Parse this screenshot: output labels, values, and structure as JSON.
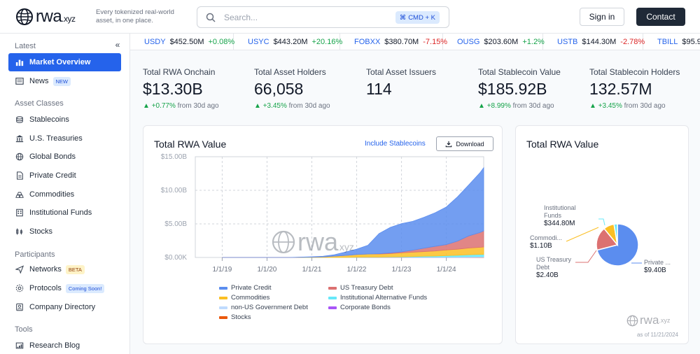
{
  "header": {
    "logo_text": "rwa",
    "logo_suffix": ".xyz",
    "tagline": "Every tokenized real-world asset, in one place.",
    "search_placeholder": "Search...",
    "search_shortcut": "CMD + K",
    "signin_label": "Sign in",
    "contact_label": "Contact"
  },
  "sidebar": {
    "latest_title": "Latest",
    "latest": [
      {
        "label": "Market Overview",
        "icon": "chart-bars-icon",
        "active": true
      },
      {
        "label": "News",
        "icon": "news-icon",
        "badge": "NEW"
      }
    ],
    "asset_title": "Asset Classes",
    "assets": [
      {
        "label": "Stablecoins",
        "icon": "coins-icon"
      },
      {
        "label": "U.S. Treasuries",
        "icon": "bank-icon"
      },
      {
        "label": "Global Bonds",
        "icon": "globe-icon"
      },
      {
        "label": "Private Credit",
        "icon": "document-icon"
      },
      {
        "label": "Commodities",
        "icon": "gold-bars-icon"
      },
      {
        "label": "Institutional Funds",
        "icon": "building-icon"
      },
      {
        "label": "Stocks",
        "icon": "stock-chart-icon"
      }
    ],
    "participants_title": "Participants",
    "participants": [
      {
        "label": "Networks",
        "icon": "network-icon",
        "badge": "BETA"
      },
      {
        "label": "Protocols",
        "icon": "protocol-icon",
        "badge": "Coming Soon!"
      },
      {
        "label": "Company Directory",
        "icon": "directory-icon"
      }
    ],
    "tools_title": "Tools",
    "tools": [
      {
        "label": "Research Blog",
        "icon": "blog-icon"
      }
    ]
  },
  "ticker": [
    {
      "symbol": "USDY",
      "value": "$452.50M",
      "change": "+0.08%",
      "dir": "pos"
    },
    {
      "symbol": "USYC",
      "value": "$443.20M",
      "change": "+20.16%",
      "dir": "pos"
    },
    {
      "symbol": "FOBXX",
      "value": "$380.70M",
      "change": "-7.15%",
      "dir": "neg"
    },
    {
      "symbol": "OUSG",
      "value": "$203.60M",
      "change": "+1.2%",
      "dir": "pos"
    },
    {
      "symbol": "USTB",
      "value": "$144.30M",
      "change": "-2.78%",
      "dir": "neg"
    },
    {
      "symbol": "TBILL",
      "value": "$95.9",
      "change": "",
      "dir": "pos"
    }
  ],
  "stats": [
    {
      "label": "Total RWA Onchain",
      "value": "$13.30B",
      "change": "+0.77%",
      "suffix": "from 30d ago"
    },
    {
      "label": "Total Asset Holders",
      "value": "66,058",
      "change": "+3.45%",
      "suffix": "from 30d ago"
    },
    {
      "label": "Total Asset Issuers",
      "value": "114",
      "change": "",
      "suffix": ""
    },
    {
      "label": "Total Stablecoin Value",
      "value": "$185.92B",
      "change": "+8.99%",
      "suffix": "from 30d ago"
    },
    {
      "label": "Total Stablecoin Holders",
      "value": "132.57M",
      "change": "+3.45%",
      "suffix": "from 30d ago"
    }
  ],
  "area_card": {
    "title": "Total RWA Value",
    "include_label": "Include Stablecoins",
    "download_label": "Download",
    "watermark_text": "rwa",
    "watermark_suffix": ".xyz"
  },
  "pie_card": {
    "title": "Total RWA Value",
    "watermark_text": "rwa",
    "watermark_suffix": ".xyz",
    "asof": "as of 11/21/2024",
    "labels": [
      {
        "name": "Institutional Funds",
        "value": "$344.80M"
      },
      {
        "name": "Commodi...",
        "value": "$1.10B"
      },
      {
        "name": "US Treasury Debt",
        "value": "$2.40B"
      },
      {
        "name": "Private ...",
        "value": "$9.40B"
      }
    ]
  },
  "chart_data": [
    {
      "type": "area",
      "title": "Total RWA Value",
      "y_ticks": [
        "$0.00K",
        "$5.00B",
        "$10.00B",
        "$15.00B"
      ],
      "ylim": [
        0,
        15
      ],
      "y_unit": "B",
      "x_ticks": [
        "1/1/19",
        "1/1/20",
        "1/1/21",
        "1/1/22",
        "1/1/23",
        "1/1/24"
      ],
      "x": [
        "2019-01",
        "2019-07",
        "2020-01",
        "2020-07",
        "2021-01",
        "2021-04",
        "2021-07",
        "2021-10",
        "2022-01",
        "2022-04",
        "2022-07",
        "2022-10",
        "2023-01",
        "2023-04",
        "2023-07",
        "2023-10",
        "2024-01",
        "2024-04",
        "2024-07",
        "2024-10",
        "2024-11"
      ],
      "series": [
        {
          "name": "Stocks",
          "color": "#ea580c",
          "values": [
            0,
            0,
            0,
            0,
            0,
            0,
            0,
            0,
            0,
            0,
            0,
            0,
            0,
            0,
            0,
            0,
            0,
            0,
            0.02,
            0.03,
            0.03
          ]
        },
        {
          "name": "Corporate Bonds",
          "color": "#a855f7",
          "values": [
            0,
            0,
            0,
            0,
            0,
            0,
            0,
            0,
            0.01,
            0.01,
            0.01,
            0.01,
            0.01,
            0.01,
            0.01,
            0.01,
            0.01,
            0.01,
            0.01,
            0.01,
            0.01
          ]
        },
        {
          "name": "non-US Government Debt",
          "color": "#bfdbfe",
          "values": [
            0,
            0,
            0,
            0,
            0,
            0,
            0,
            0,
            0.01,
            0.02,
            0.02,
            0.03,
            0.03,
            0.04,
            0.05,
            0.05,
            0.06,
            0.07,
            0.08,
            0.08,
            0.08
          ]
        },
        {
          "name": "Institutional Alternative Funds",
          "color": "#67e8f9",
          "values": [
            0,
            0,
            0,
            0,
            0,
            0,
            0,
            0,
            0.02,
            0.03,
            0.03,
            0.04,
            0.05,
            0.08,
            0.12,
            0.15,
            0.2,
            0.25,
            0.3,
            0.34,
            0.34
          ]
        },
        {
          "name": "Commodities",
          "color": "#fbbf24",
          "values": [
            0,
            0,
            0,
            0,
            0.05,
            0.1,
            0.2,
            0.3,
            0.4,
            0.45,
            0.45,
            0.5,
            0.6,
            0.65,
            0.7,
            0.75,
            0.85,
            0.9,
            1.0,
            1.05,
            1.1
          ]
        },
        {
          "name": "US Treasury Debt",
          "color": "#dc7171",
          "values": [
            0,
            0,
            0,
            0,
            0,
            0,
            0,
            0,
            0,
            0,
            0.05,
            0.1,
            0.15,
            0.3,
            0.5,
            0.7,
            0.8,
            1.2,
            1.8,
            2.2,
            2.4
          ]
        },
        {
          "name": "Private Credit",
          "color": "#5b8def",
          "values": [
            0,
            0,
            0,
            0,
            0.05,
            0.08,
            0.2,
            0.5,
            0.8,
            1.3,
            3.0,
            3.8,
            4.2,
            4.3,
            4.6,
            5.0,
            5.6,
            6.6,
            7.6,
            8.9,
            9.4
          ]
        }
      ],
      "legend_order": [
        "Private Credit",
        "US Treasury Debt",
        "Commodities",
        "Institutional Alternative Funds",
        "non-US Government Debt",
        "Corporate Bonds",
        "Stocks"
      ],
      "legend": "bottom"
    },
    {
      "type": "pie",
      "title": "Total RWA Value",
      "slices": [
        {
          "name": "Private Credit",
          "value": 9.4,
          "color": "#5b8def"
        },
        {
          "name": "US Treasury Debt",
          "value": 2.4,
          "color": "#dc7171"
        },
        {
          "name": "Commodities",
          "value": 1.1,
          "color": "#fbbf24"
        },
        {
          "name": "Institutional Funds",
          "value": 0.3448,
          "color": "#67e8f9"
        }
      ]
    }
  ]
}
